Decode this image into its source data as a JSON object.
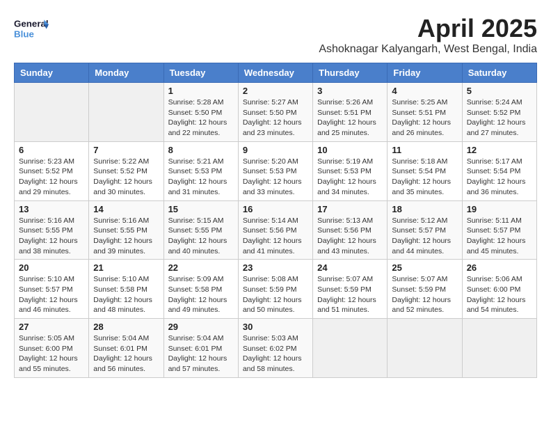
{
  "header": {
    "logo_general": "General",
    "logo_blue": "Blue",
    "month_title": "April 2025",
    "location": "Ashoknagar Kalyangarh, West Bengal, India"
  },
  "weekdays": [
    "Sunday",
    "Monday",
    "Tuesday",
    "Wednesday",
    "Thursday",
    "Friday",
    "Saturday"
  ],
  "weeks": [
    [
      {
        "day": "",
        "info": ""
      },
      {
        "day": "",
        "info": ""
      },
      {
        "day": "1",
        "info": "Sunrise: 5:28 AM\nSunset: 5:50 PM\nDaylight: 12 hours and 22 minutes."
      },
      {
        "day": "2",
        "info": "Sunrise: 5:27 AM\nSunset: 5:50 PM\nDaylight: 12 hours and 23 minutes."
      },
      {
        "day": "3",
        "info": "Sunrise: 5:26 AM\nSunset: 5:51 PM\nDaylight: 12 hours and 25 minutes."
      },
      {
        "day": "4",
        "info": "Sunrise: 5:25 AM\nSunset: 5:51 PM\nDaylight: 12 hours and 26 minutes."
      },
      {
        "day": "5",
        "info": "Sunrise: 5:24 AM\nSunset: 5:52 PM\nDaylight: 12 hours and 27 minutes."
      }
    ],
    [
      {
        "day": "6",
        "info": "Sunrise: 5:23 AM\nSunset: 5:52 PM\nDaylight: 12 hours and 29 minutes."
      },
      {
        "day": "7",
        "info": "Sunrise: 5:22 AM\nSunset: 5:52 PM\nDaylight: 12 hours and 30 minutes."
      },
      {
        "day": "8",
        "info": "Sunrise: 5:21 AM\nSunset: 5:53 PM\nDaylight: 12 hours and 31 minutes."
      },
      {
        "day": "9",
        "info": "Sunrise: 5:20 AM\nSunset: 5:53 PM\nDaylight: 12 hours and 33 minutes."
      },
      {
        "day": "10",
        "info": "Sunrise: 5:19 AM\nSunset: 5:53 PM\nDaylight: 12 hours and 34 minutes."
      },
      {
        "day": "11",
        "info": "Sunrise: 5:18 AM\nSunset: 5:54 PM\nDaylight: 12 hours and 35 minutes."
      },
      {
        "day": "12",
        "info": "Sunrise: 5:17 AM\nSunset: 5:54 PM\nDaylight: 12 hours and 36 minutes."
      }
    ],
    [
      {
        "day": "13",
        "info": "Sunrise: 5:16 AM\nSunset: 5:55 PM\nDaylight: 12 hours and 38 minutes."
      },
      {
        "day": "14",
        "info": "Sunrise: 5:16 AM\nSunset: 5:55 PM\nDaylight: 12 hours and 39 minutes."
      },
      {
        "day": "15",
        "info": "Sunrise: 5:15 AM\nSunset: 5:55 PM\nDaylight: 12 hours and 40 minutes."
      },
      {
        "day": "16",
        "info": "Sunrise: 5:14 AM\nSunset: 5:56 PM\nDaylight: 12 hours and 41 minutes."
      },
      {
        "day": "17",
        "info": "Sunrise: 5:13 AM\nSunset: 5:56 PM\nDaylight: 12 hours and 43 minutes."
      },
      {
        "day": "18",
        "info": "Sunrise: 5:12 AM\nSunset: 5:57 PM\nDaylight: 12 hours and 44 minutes."
      },
      {
        "day": "19",
        "info": "Sunrise: 5:11 AM\nSunset: 5:57 PM\nDaylight: 12 hours and 45 minutes."
      }
    ],
    [
      {
        "day": "20",
        "info": "Sunrise: 5:10 AM\nSunset: 5:57 PM\nDaylight: 12 hours and 46 minutes."
      },
      {
        "day": "21",
        "info": "Sunrise: 5:10 AM\nSunset: 5:58 PM\nDaylight: 12 hours and 48 minutes."
      },
      {
        "day": "22",
        "info": "Sunrise: 5:09 AM\nSunset: 5:58 PM\nDaylight: 12 hours and 49 minutes."
      },
      {
        "day": "23",
        "info": "Sunrise: 5:08 AM\nSunset: 5:59 PM\nDaylight: 12 hours and 50 minutes."
      },
      {
        "day": "24",
        "info": "Sunrise: 5:07 AM\nSunset: 5:59 PM\nDaylight: 12 hours and 51 minutes."
      },
      {
        "day": "25",
        "info": "Sunrise: 5:07 AM\nSunset: 5:59 PM\nDaylight: 12 hours and 52 minutes."
      },
      {
        "day": "26",
        "info": "Sunrise: 5:06 AM\nSunset: 6:00 PM\nDaylight: 12 hours and 54 minutes."
      }
    ],
    [
      {
        "day": "27",
        "info": "Sunrise: 5:05 AM\nSunset: 6:00 PM\nDaylight: 12 hours and 55 minutes."
      },
      {
        "day": "28",
        "info": "Sunrise: 5:04 AM\nSunset: 6:01 PM\nDaylight: 12 hours and 56 minutes."
      },
      {
        "day": "29",
        "info": "Sunrise: 5:04 AM\nSunset: 6:01 PM\nDaylight: 12 hours and 57 minutes."
      },
      {
        "day": "30",
        "info": "Sunrise: 5:03 AM\nSunset: 6:02 PM\nDaylight: 12 hours and 58 minutes."
      },
      {
        "day": "",
        "info": ""
      },
      {
        "day": "",
        "info": ""
      },
      {
        "day": "",
        "info": ""
      }
    ]
  ]
}
